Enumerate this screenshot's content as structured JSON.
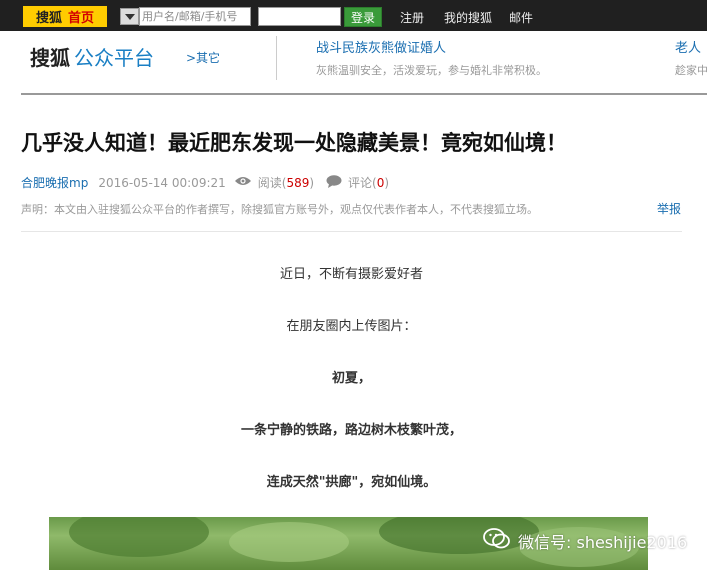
{
  "topbar": {
    "logo_brand": "搜狐",
    "logo_home": "首页",
    "username_placeholder": "用户名/邮箱/手机号",
    "login_label": "登录",
    "links": [
      "注册",
      "我的搜狐",
      "邮件"
    ]
  },
  "header": {
    "brand": "搜狐",
    "platform": "公众平台",
    "other_link": ">其它",
    "headlines": [
      {
        "title": "战斗民族灰熊做证婚人",
        "sub": "灰熊温驯安全，活泼爱玩，参与婚礼非常积极。"
      },
      {
        "title": "老人",
        "sub": "趁家中"
      }
    ]
  },
  "article": {
    "title": "几乎没人知道！最近肥东发现一处隐藏美景！竟宛如仙境！",
    "author": "合肥晚报mp",
    "datetime": "2016-05-14 00:09:21",
    "read_label": "阅读(",
    "read_count": "589",
    "read_close": ")",
    "comment_label": "评论(",
    "comment_count": "0",
    "comment_close": ")",
    "disclaimer": "声明：本文由入驻搜狐公众平台的作者撰写，除搜狐官方账号外，观点仅代表作者本人，不代表搜狐立场。",
    "report_label": "举报",
    "paragraphs": [
      {
        "text": "近日，不断有摄影爱好者",
        "bold": false
      },
      {
        "text": "在朋友圈内上传图片：",
        "bold": false
      },
      {
        "text": "初夏，",
        "bold": true
      },
      {
        "text": "一条宁静的铁路，路边树木枝繁叶茂，",
        "bold": true
      },
      {
        "text": "连成天然\"拱廊\"，宛如仙境。",
        "bold": true
      }
    ],
    "watermark": "微信号: sheshijie2016"
  },
  "colors": {
    "topbar_bg": "#202020",
    "logo_bg": "#ffcc00",
    "link_blue": "#1a6eb0",
    "count_red": "#cc0000",
    "login_green": "#3a9b3a"
  }
}
